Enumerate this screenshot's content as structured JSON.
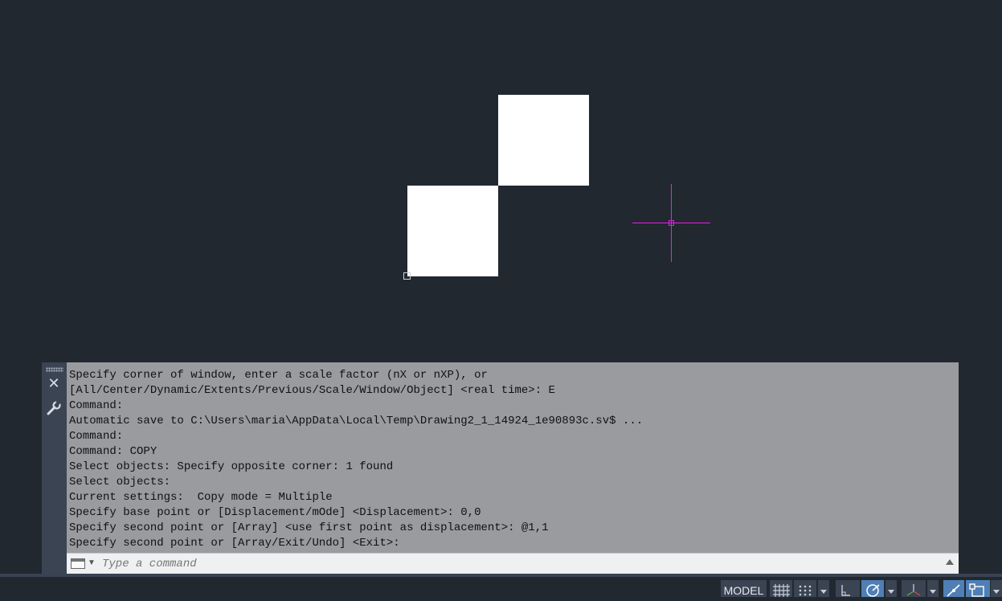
{
  "command_history": [
    "Specify corner of window, enter a scale factor (nX or nXP), or",
    "[All/Center/Dynamic/Extents/Previous/Scale/Window/Object] <real time>: E",
    "Command:",
    "Automatic save to C:\\Users\\maria\\AppData\\Local\\Temp\\Drawing2_1_14924_1e90893c.sv$ ...",
    "Command:",
    "Command: COPY",
    "Select objects: Specify opposite corner: 1 found",
    "Select objects:",
    "Current settings:  Copy mode = Multiple",
    "Specify base point or [Displacement/mOde] <Displacement>: 0,0",
    "Specify second point or [Array] <use first point as displacement>: @1,1",
    "Specify second point or [Array/Exit/Undo] <Exit>:"
  ],
  "command_input": {
    "placeholder": "Type a command",
    "value": ""
  },
  "status_bar": {
    "model_label": "MODEL"
  },
  "colors": {
    "canvas": "#212830",
    "crosshair": "#e81ee8",
    "entity": "#ffffff",
    "history_bg": "#999b9f",
    "active_toggle": "#4f7fb5"
  },
  "icons": [
    "grip-icon",
    "close-icon",
    "wrench-icon",
    "command-prompt-icon",
    "grid-icon",
    "snap-icon",
    "infer-constraints-icon",
    "ortho-icon",
    "polar-tracking-icon",
    "isometric-icon",
    "object-snap-tracking-icon",
    "object-snap-icon"
  ]
}
